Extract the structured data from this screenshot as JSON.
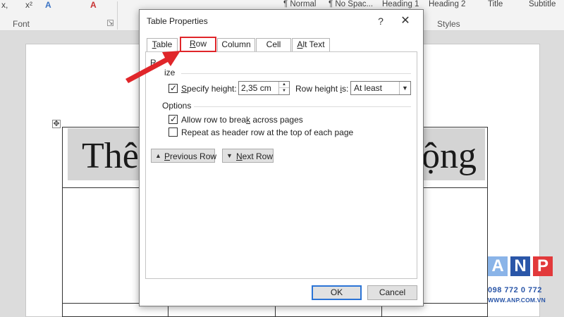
{
  "ribbon": {
    "format_marks": [
      "x,",
      "x²",
      "A",
      "A"
    ],
    "styles": [
      "¶ Normal",
      "¶ No Spac...",
      "Heading 1",
      "Heading 2",
      "Title",
      "Subtitle"
    ],
    "group_labels": {
      "font": "Font",
      "styles": "Styles"
    }
  },
  "document": {
    "heading_left": "Thê",
    "heading_right": "ộng"
  },
  "logo": {
    "letters": [
      "A",
      "N",
      "P"
    ],
    "phone": "098 772 0 772",
    "url": "WWW.ANP.COM.VN",
    "colors": {
      "a": "#8ab4e8",
      "n": "#2a56a8",
      "p": "#e2393b"
    }
  },
  "dialog": {
    "title": "Table Properties",
    "help_glyph": "?",
    "close_glyph": "✕",
    "tabs": [
      {
        "label": "Table",
        "mnemonic": "T",
        "rest": "able"
      },
      {
        "label": "Row",
        "mnemonic": "R",
        "rest": "ow"
      },
      {
        "label": "Column",
        "mnemonic": "",
        "rest": "Column"
      },
      {
        "label": "Cell",
        "mnemonic": "",
        "rest": "Cell"
      },
      {
        "label": "Alt Text",
        "mnemonic": "A",
        "rest": "lt Text"
      }
    ],
    "active_tab": "Row",
    "panel_heading_fragment": "R",
    "size": {
      "heading_fragment": "ize",
      "specify_height_label_mnemonic": "S",
      "specify_height_label_rest": "pecify height:",
      "specify_height_checked": true,
      "height_value": "2,35 cm",
      "row_height_is_label": "Row height ",
      "row_height_is_mnemonic": "i",
      "row_height_is_tail": "s:",
      "row_height_mode": "At least"
    },
    "options": {
      "heading": "Options",
      "allow_break_label_1": "Allow row to brea",
      "allow_break_mnemonic": "k",
      "allow_break_label_2": " across pages",
      "allow_break_checked": true,
      "repeat_header_label": "Repeat as header row at the top of each page",
      "repeat_header_checked": false
    },
    "previous_row": {
      "mnemonic": "P",
      "rest": "revious Row"
    },
    "next_row": {
      "mnemonic": "N",
      "rest": "ext Row"
    },
    "ok_label": "OK",
    "cancel_label": "Cancel"
  },
  "annotation": {
    "arrow_color": "#e0262a",
    "highlight_color": "#e0262a"
  }
}
